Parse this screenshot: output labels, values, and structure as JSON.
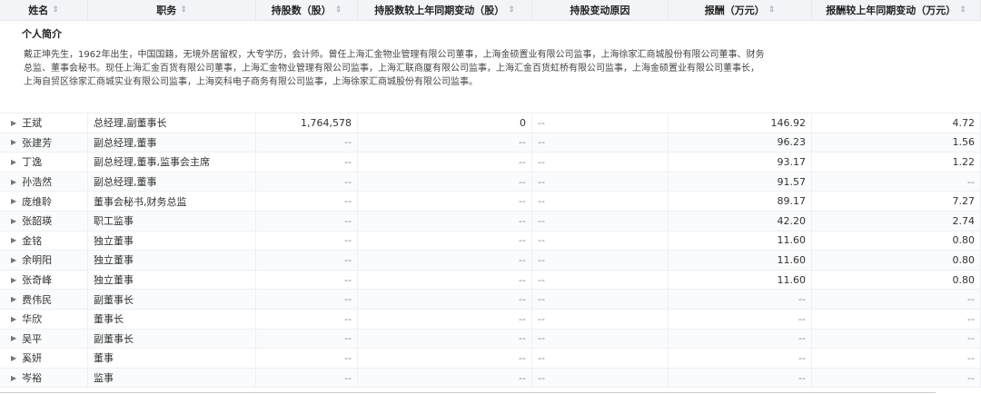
{
  "headers": {
    "name": "姓名",
    "role": "职务",
    "shares": "持股数（股）",
    "share_change": "持股数较上年同期变动（股）",
    "reason": "持股变动原因",
    "pay": "报酬（万元）",
    "pay_change": "报酬较上年同期变动（万元）"
  },
  "sort_glyph": "⇕",
  "bio": {
    "title": "个人简介",
    "line1": "戴正坤先生，1962年出生，中国国籍，无境外居留权，大专学历，会计师。曾任上海汇金物业管理有限公司董事，上海金硕置业有限公司监事，上海徐家汇商城股份有限公司董事、财务",
    "line2": "总监、董事会秘书。现任上海汇金百货有限公司董事，上海汇金物业管理有限公司监事，上海汇联商厦有限公司监事，上海汇金百货虹桥有限公司监事，上海金硕置业有限公司董事长，",
    "line3": "上海自贸区徐家汇商城实业有限公司监事，上海奕科电子商务有限公司监事，上海徐家汇商城股份有限公司监事。"
  },
  "rows": [
    {
      "name": "王斌",
      "role": "总经理,副董事长",
      "shares": "1,764,578",
      "change": "0",
      "reason": "--",
      "pay": "146.92",
      "pay_change": "4.72"
    },
    {
      "name": "张建芳",
      "role": "副总经理,董事",
      "shares": "--",
      "change": "--",
      "reason": "--",
      "pay": "96.23",
      "pay_change": "1.56"
    },
    {
      "name": "丁逸",
      "role": "副总经理,董事,监事会主席",
      "shares": "--",
      "change": "--",
      "reason": "--",
      "pay": "93.17",
      "pay_change": "1.22"
    },
    {
      "name": "孙浩然",
      "role": "副总经理,董事",
      "shares": "--",
      "change": "--",
      "reason": "--",
      "pay": "91.57",
      "pay_change": "--"
    },
    {
      "name": "庞维聆",
      "role": "董事会秘书,财务总监",
      "shares": "--",
      "change": "--",
      "reason": "--",
      "pay": "89.17",
      "pay_change": "7.27"
    },
    {
      "name": "张韶瑛",
      "role": "职工监事",
      "shares": "--",
      "change": "--",
      "reason": "--",
      "pay": "42.20",
      "pay_change": "2.74"
    },
    {
      "name": "金铭",
      "role": "独立董事",
      "shares": "--",
      "change": "--",
      "reason": "--",
      "pay": "11.60",
      "pay_change": "0.80"
    },
    {
      "name": "余明阳",
      "role": "独立董事",
      "shares": "--",
      "change": "--",
      "reason": "--",
      "pay": "11.60",
      "pay_change": "0.80"
    },
    {
      "name": "张奇峰",
      "role": "独立董事",
      "shares": "--",
      "change": "--",
      "reason": "--",
      "pay": "11.60",
      "pay_change": "0.80"
    },
    {
      "name": "费伟民",
      "role": "副董事长",
      "shares": "--",
      "change": "--",
      "reason": "--",
      "pay": "--",
      "pay_change": "--"
    },
    {
      "name": "华欣",
      "role": "董事长",
      "shares": "--",
      "change": "--",
      "reason": "--",
      "pay": "--",
      "pay_change": "--"
    },
    {
      "name": "吴平",
      "role": "副董事长",
      "shares": "--",
      "change": "--",
      "reason": "--",
      "pay": "--",
      "pay_change": "--"
    },
    {
      "name": "奚妍",
      "role": "董事",
      "shares": "--",
      "change": "--",
      "reason": "--",
      "pay": "--",
      "pay_change": "--"
    },
    {
      "name": "岑裕",
      "role": "监事",
      "shares": "--",
      "change": "--",
      "reason": "--",
      "pay": "--",
      "pay_change": "--"
    }
  ]
}
